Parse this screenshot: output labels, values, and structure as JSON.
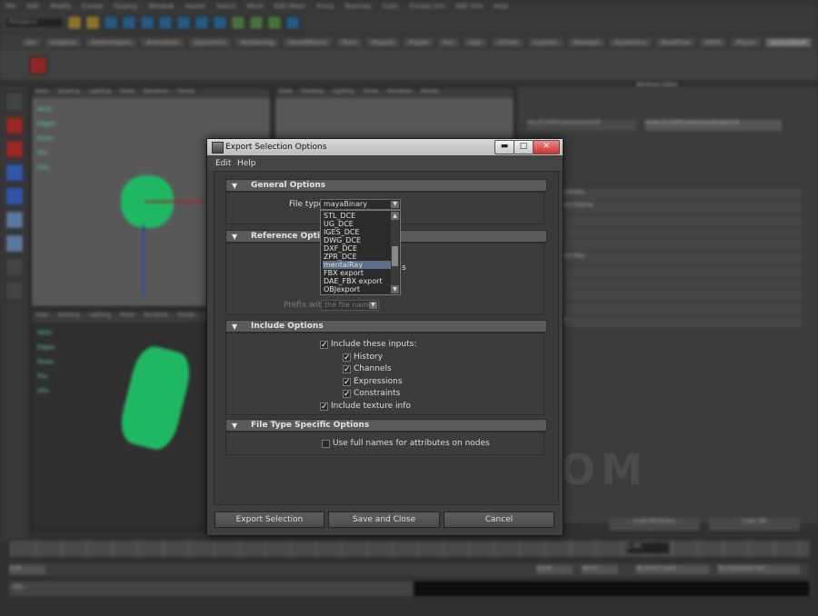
{
  "dialog": {
    "title": "Export Selection Options",
    "window_buttons": {
      "minimize": "▬",
      "maximize": "□",
      "close": "✕"
    },
    "menu": [
      "Edit",
      "Help"
    ],
    "sections": {
      "general": "General Options",
      "reference": "Reference Options",
      "include": "Include Options",
      "file_type": "File Type Specific Options"
    },
    "file_type_label": "File type:",
    "file_type_value": "mayaBinary",
    "file_type_options": [
      "STL_DCE",
      "UG_DCE",
      "IGES_DCE",
      "DWG_DCE",
      "DXF_DCE",
      "ZPR_DCE",
      "mentalRay",
      "FBX export",
      "DAE_FBX export",
      "OBJexport"
    ],
    "file_type_highlighted": "mentalRay",
    "reference_visible_char": "s",
    "prefix_label": "Prefix with:",
    "prefix_value": "the file name",
    "include_inputs": {
      "label": "Include these inputs:",
      "checked": true
    },
    "inputs": [
      {
        "label": "History",
        "checked": true
      },
      {
        "label": "Channels",
        "checked": true
      },
      {
        "label": "Expressions",
        "checked": true
      },
      {
        "label": "Constraints",
        "checked": true
      }
    ],
    "include_texture": {
      "label": "Include texture info",
      "checked": true
    },
    "full_names": {
      "label": "Use full names for attributes on nodes",
      "checked": false
    },
    "buttons": {
      "export": "Export Selection",
      "save_close": "Save and Close",
      "cancel": "Cancel"
    }
  },
  "background": {
    "watermark": "ONUBOSH.COM",
    "attribute_editor_title": "Attribute Editor",
    "shelf_tabs": [
      "Ge",
      "Subdivs",
      "Deformation",
      "Animation",
      "Dynamics",
      "Rendering",
      "PaintEffects",
      "Toon",
      "Muscle",
      "Fluids",
      "Fur",
      "Hair",
      "nCloth",
      "Custom",
      "Maxwell",
      "Dynamics",
      "RealFlow",
      "DMM",
      "Physx",
      "ActiveShelf"
    ],
    "menus": [
      "File",
      "Edit",
      "Modify",
      "Create",
      "Display",
      "Window",
      "Assets",
      "Select",
      "Mesh",
      "Edit Mesh",
      "Proxy",
      "Normals",
      "Color",
      "Create UVs",
      "Edit UVs",
      "Help"
    ],
    "selection_mode": "Polygons",
    "viewport_menu": [
      "View",
      "Shading",
      "Lighting",
      "Show",
      "Renderer",
      "Panels"
    ],
    "hud": [
      "Verts:",
      "Edges:",
      "Faces:",
      "Tris:",
      "UVs:"
    ],
    "attr_rows": [
      "Bullet Attributes",
      "Component Display",
      "Controls",
      "Space",
      "Mesh",
      "Component Map",
      "Stats",
      "Display",
      "Map",
      "Selector",
      "Attributes"
    ],
    "node_name": "pCube_ID_STATIC:polySurfaceShape2128",
    "shape_name": "ribs_ID_STATIC:polySurface2128",
    "current_frame": "1.00",
    "range_start": "1.00",
    "range_end": "24.00",
    "range_max": "48.00",
    "anim_layer": "No Anim Layer",
    "char_set": "No Character Set",
    "cmd_label": "MEL",
    "ae_buttons": [
      "Load Attributes",
      "Copy Tab"
    ]
  }
}
